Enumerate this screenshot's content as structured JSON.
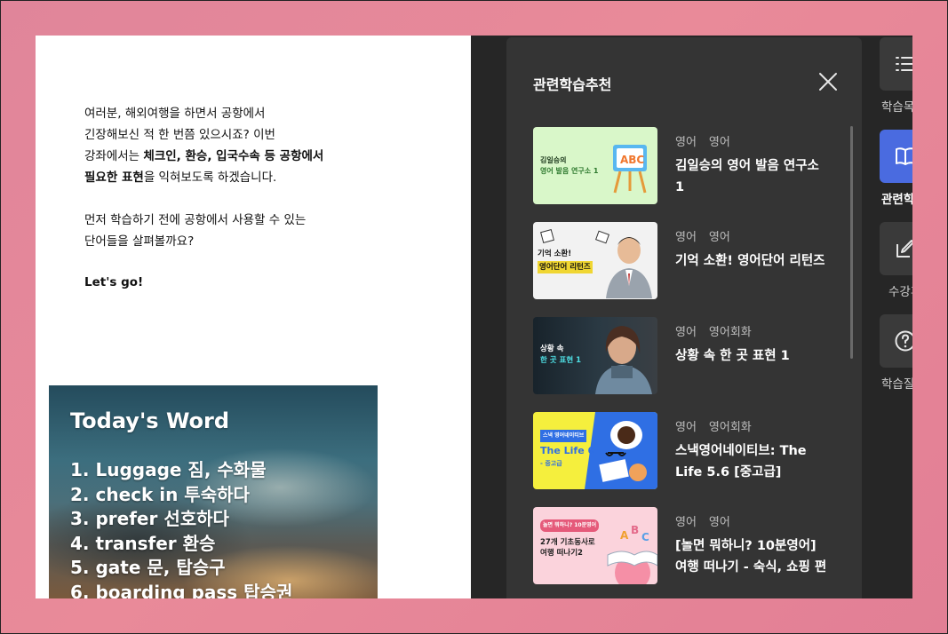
{
  "article": {
    "intro_line1": "여러분, 해외여행을 하면서 공항에서",
    "intro_line2": "긴장해보신 적 한 번쯤 있으시죠? 이번",
    "intro_line3_pre": "강좌에서는 ",
    "intro_line3_bold": "체크인, 환승, 입국수속 등 공항에서",
    "intro_line4_bold": "필요한 표현",
    "intro_line4_post": "을 익혀보도록 하겠습니다.",
    "intro2_line1": "먼저 학습하기 전에 공항에서 사용할 수 있는",
    "intro2_line2": "단어들을 살펴볼까요?",
    "letsgo": "Let's go!",
    "word_card": {
      "title": "Today's Word",
      "items": [
        "1. Luggage 짐, 수화물",
        "2. check in 투숙하다",
        "3. prefer 선호하다",
        "4. transfer 환승",
        "5. gate 문, 탑승구",
        "6. boarding pass 탑승권"
      ]
    }
  },
  "panel": {
    "title": "관련학습추천",
    "close_icon": "close-icon",
    "cards": [
      {
        "tag1": "영어",
        "tag2": "영어",
        "title": "김일승의 영어 발음 연구소 1",
        "thumb_line1": "김일승의",
        "thumb_line2": "영어 발음 연구소 1",
        "thumb_bg": "#d9f7c9"
      },
      {
        "tag1": "영어",
        "tag2": "영어",
        "title": "기억 소환! 영어단어 리턴즈",
        "thumb_line1": "기억 소환!",
        "thumb_line2": "영어단어 리턴즈",
        "thumb_bg": "#f2f2f2"
      },
      {
        "tag1": "영어",
        "tag2": "영어회화",
        "title": "상황 속 한 곳 표현 1",
        "thumb_line1": "상황 속",
        "thumb_line2": "한 곳 표현 1",
        "thumb_bg": "#1e2a33"
      },
      {
        "tag1": "영어",
        "tag2": "영어회화",
        "title": "스낵영어네이티브: The Life 5.6 [중고급]",
        "thumb_badge": "스낵 영어네이티브",
        "thumb_line1": "The Life 6",
        "thumb_line2": "- 중고급",
        "thumb_bg": "#f5ef3d"
      },
      {
        "tag1": "영어",
        "tag2": "영어",
        "title": "[놀면 뭐하니? 10분영어] 여행 떠나기 - 숙식, 쇼핑 편",
        "thumb_badge": "놀면 뭐하니? 10분영어",
        "thumb_line1": "27개 기초동사로",
        "thumb_line2": "여행 떠나기2",
        "thumb_bg": "#fbd3dc"
      }
    ]
  },
  "rail": [
    {
      "icon": "list-icon",
      "label": "학습목차",
      "active": false
    },
    {
      "icon": "book-icon",
      "label": "관련학습",
      "active": true
    },
    {
      "icon": "edit-icon",
      "label": "수강후기",
      "active": false
    },
    {
      "icon": "question-icon",
      "label": "학습질문",
      "active": false
    }
  ]
}
